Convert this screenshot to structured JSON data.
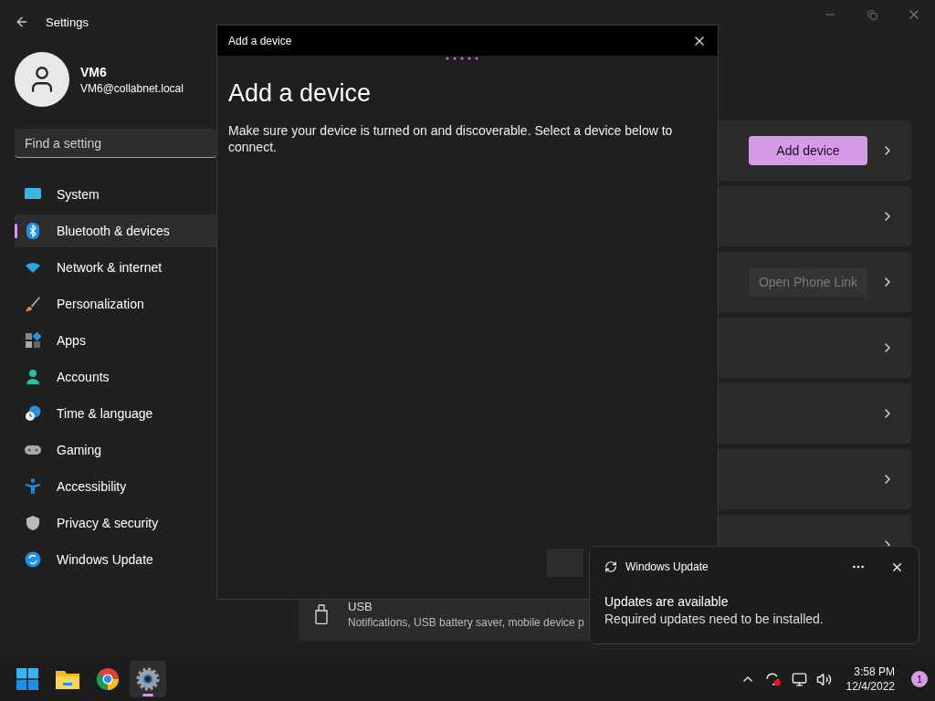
{
  "window": {
    "title": "Settings"
  },
  "profile": {
    "name": "VM6",
    "email": "VM6@collabnet.local"
  },
  "search": {
    "placeholder": "Find a setting"
  },
  "nav": [
    {
      "label": "System",
      "kind": "system",
      "selected": false
    },
    {
      "label": "Bluetooth & devices",
      "kind": "bluetooth",
      "selected": true
    },
    {
      "label": "Network & internet",
      "kind": "network",
      "selected": false
    },
    {
      "label": "Personalization",
      "kind": "brush",
      "selected": false
    },
    {
      "label": "Apps",
      "kind": "apps",
      "selected": false
    },
    {
      "label": "Accounts",
      "kind": "accounts",
      "selected": false
    },
    {
      "label": "Time & language",
      "kind": "time",
      "selected": false
    },
    {
      "label": "Gaming",
      "kind": "gaming",
      "selected": false
    },
    {
      "label": "Accessibility",
      "kind": "accessibility",
      "selected": false
    },
    {
      "label": "Privacy & security",
      "kind": "privacy",
      "selected": false
    },
    {
      "label": "Windows Update",
      "kind": "update",
      "selected": false
    }
  ],
  "cards": [
    {
      "kind": "action",
      "button": "Add device",
      "disabled": false
    },
    {
      "kind": "plain"
    },
    {
      "kind": "action",
      "button": "Open Phone Link",
      "disabled": true
    },
    {
      "kind": "plain"
    },
    {
      "kind": "plain"
    },
    {
      "kind": "plain"
    },
    {
      "kind": "plain"
    },
    {
      "kind": "info",
      "title": "USB",
      "description": "Notifications, USB battery saver, mobile device p"
    }
  ],
  "dialog": {
    "title": "Add a device",
    "heading": "Add a device",
    "text": "Make sure your device is turned on and discoverable. Select a device below to connect."
  },
  "toast": {
    "app": "Windows Update",
    "title": "Updates are available",
    "body": "Required updates need to be installed."
  },
  "taskbar": {
    "apps": [
      {
        "kind": "start",
        "selected": false
      },
      {
        "kind": "explorer",
        "selected": false
      },
      {
        "kind": "browser",
        "selected": false
      },
      {
        "kind": "settings",
        "selected": true
      }
    ],
    "time": "3:58 PM",
    "date": "12/4/2022",
    "notifications": "1"
  }
}
